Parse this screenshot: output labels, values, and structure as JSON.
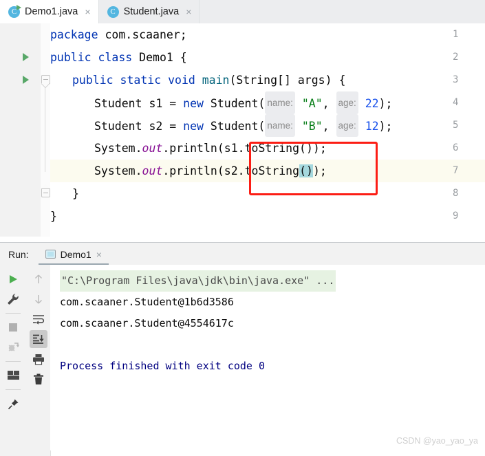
{
  "editor_tabs": [
    {
      "label": "Demo1.java",
      "icon": "java-runnable-class-icon",
      "active": true,
      "close": "×"
    },
    {
      "label": "Student.java",
      "icon": "java-class-icon",
      "active": false,
      "close": "×"
    }
  ],
  "editor": {
    "lines": [
      {
        "num": "1",
        "run_marker": false,
        "fold": null
      },
      {
        "num": "2",
        "run_marker": true,
        "fold": null
      },
      {
        "num": "3",
        "run_marker": true,
        "fold": "open"
      },
      {
        "num": "4",
        "run_marker": false,
        "fold": null
      },
      {
        "num": "5",
        "run_marker": false,
        "fold": null
      },
      {
        "num": "6",
        "run_marker": false,
        "fold": null
      },
      {
        "num": "7",
        "run_marker": false,
        "fold": null
      },
      {
        "num": "8",
        "run_marker": false,
        "fold": "close"
      },
      {
        "num": "9",
        "run_marker": false,
        "fold": null
      }
    ],
    "code": {
      "l1_kw": "package",
      "l1_rest": " com.scaaner;",
      "l2_kw1": "public",
      "l2_kw2": "class",
      "l2_name": "Demo1",
      "l2_brace": "{",
      "l3_kw": "public static void",
      "l3_meth": "main",
      "l3_sig": "(String[] args) {",
      "l4_type": "Student s1 = ",
      "l4_new": "new",
      "l4_ctor": " Student(",
      "l4_hint_name": "name:",
      "l4_str": "\"A\"",
      "l4_comma": ", ",
      "l4_hint_age": "age:",
      "l4_num": "22",
      "l4_end": ");",
      "l5_type": "Student s2 = ",
      "l5_new": "new",
      "l5_ctor": " Student(",
      "l5_hint_name": "name:",
      "l5_str": "\"B\"",
      "l5_comma": ", ",
      "l5_hint_age": "age:",
      "l5_num": "12",
      "l5_end": ");",
      "l6_sys": "System.",
      "l6_out": "out",
      "l6_dot": ".",
      "l6_println": "println",
      "l6_args": "(s1.toString());",
      "l7_sys": "System.",
      "l7_out": "out",
      "l7_dot": ".",
      "l7_println": "println",
      "l7_args_a": "(s2.toString",
      "l7_sel": "()",
      "l7_args_b": ");",
      "l8_brace": "}",
      "l9_brace": "}"
    },
    "current_line": "7",
    "highlight_box_color": "#fc1d14",
    "selection_color": "#a5d8dd"
  },
  "run_window": {
    "label": "Run:",
    "tab": {
      "label": "Demo1",
      "close": "×",
      "icon": "console-icon",
      "active": true
    },
    "left_toolbar": [
      {
        "name": "rerun-icon",
        "state": "enabled"
      },
      {
        "name": "settings-wrench-icon",
        "state": "enabled"
      },
      {
        "name": "stop-icon",
        "state": "disabled"
      },
      {
        "name": "rerun-failed-tests-icon",
        "state": "disabled"
      },
      {
        "name": "layout-settings-icon",
        "state": "enabled"
      },
      {
        "name": "pin-tab-icon",
        "state": "enabled"
      }
    ],
    "right_toolbar": [
      {
        "name": "up-arrow-icon",
        "state": "disabled"
      },
      {
        "name": "down-arrow-icon",
        "state": "disabled"
      },
      {
        "name": "soft-wrap-icon",
        "state": "enabled"
      },
      {
        "name": "scroll-to-end-icon",
        "state": "selected"
      },
      {
        "name": "print-icon",
        "state": "enabled"
      },
      {
        "name": "clear-all-icon",
        "state": "enabled"
      }
    ],
    "console": {
      "command_line": "\"C:\\Program Files\\java\\jdk\\bin\\java.exe\" ...",
      "output_line_1": "com.scaaner.Student@1b6d3586",
      "output_line_2": "com.scaaner.Student@4554617c",
      "exit_line": "Process finished with exit code 0",
      "command_bg": "#e6f2e2",
      "exit_color": "#000080"
    }
  },
  "watermark": "CSDN @yao_yao_ya"
}
